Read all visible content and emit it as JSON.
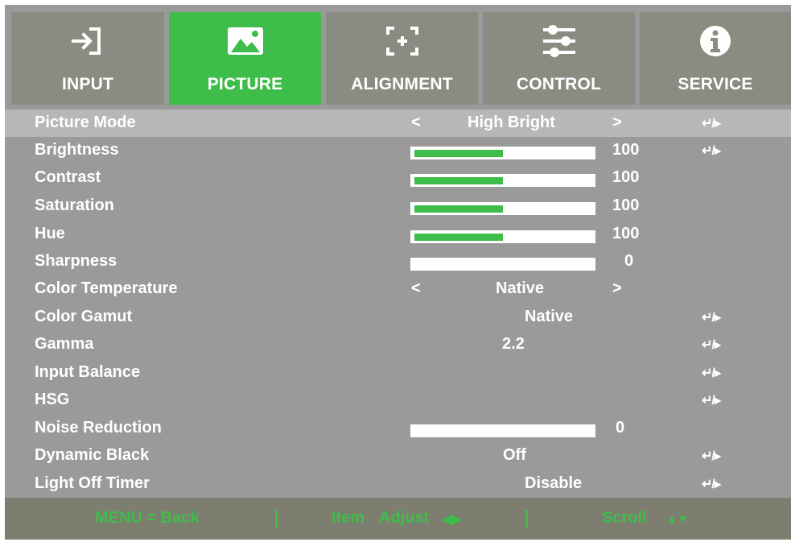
{
  "tabs": [
    {
      "label": "INPUT",
      "icon": "input-icon",
      "active": false
    },
    {
      "label": "PICTURE",
      "icon": "picture-icon",
      "active": true
    },
    {
      "label": "ALIGNMENT",
      "icon": "alignment-icon",
      "active": false
    },
    {
      "label": "CONTROL",
      "icon": "control-sliders-icon",
      "active": false
    },
    {
      "label": "SERVICE",
      "icon": "info-icon",
      "active": false
    }
  ],
  "rows": [
    {
      "label": "Picture Mode",
      "lt": "<",
      "value": "High Bright",
      "gt": ">",
      "enter": "↵/▸"
    },
    {
      "label": "Brightness",
      "bar_fill": 0.5,
      "number": "100",
      "enter": "↵/▸"
    },
    {
      "label": "Contrast",
      "bar_fill": 0.5,
      "number": "100"
    },
    {
      "label": "Saturation",
      "bar_fill": 0.5,
      "number": "100"
    },
    {
      "label": "Hue",
      "bar_fill": 0.5,
      "number": "100"
    },
    {
      "label": "Sharpness",
      "bar_fill": 0,
      "number": "0"
    },
    {
      "label": "Color Temperature",
      "lt": "<",
      "value": "Native",
      "gt": ">"
    },
    {
      "label": "Color Gamut",
      "value": "Native",
      "enter": "↵/▸"
    },
    {
      "label": "Gamma",
      "value": "2.2",
      "enter": "↵/▸"
    },
    {
      "label": "Input Balance",
      "enter": "↵/▸"
    },
    {
      "label": "HSG",
      "enter": "↵/▸"
    },
    {
      "label": "Noise Reduction",
      "bar_fill": 0,
      "number": "0"
    },
    {
      "label": "Dynamic Black",
      "value": "Off",
      "enter": "↵/▸"
    },
    {
      "label": "Light Off Timer",
      "value": "Disable",
      "enter": "↵/▸"
    }
  ],
  "footer": {
    "back": "MENU = Back",
    "item": "Item",
    "adjust": "Adjust",
    "adjust_arrows": "◀▶",
    "scroll": "Scroll",
    "scroll_arrows": "▲▼"
  },
  "colors": {
    "accent": "#3ebd4a",
    "panel": "#9a9a9a",
    "tab": "#8b8c81",
    "selected_row": "#b7b7b7",
    "footer": "#7d7e70"
  }
}
